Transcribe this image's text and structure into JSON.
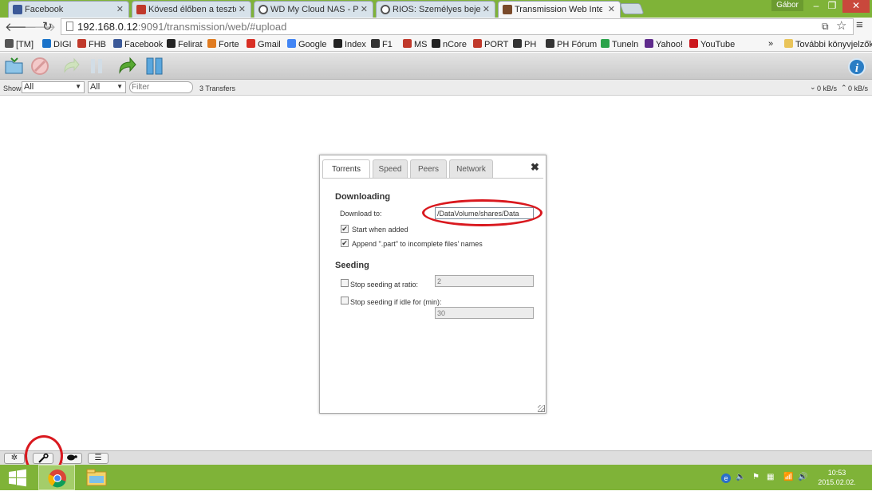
{
  "browser": {
    "tabs": [
      {
        "label": "Facebook",
        "active": false,
        "favicon_color": "#3b5998"
      },
      {
        "label": "Kövesd élőben a tesztet! -",
        "active": false,
        "favicon_color": "#c0392b"
      },
      {
        "label": "WD My Cloud NAS - PRO",
        "active": false,
        "favicon_color": "#555555"
      },
      {
        "label": "RIOS: Személyes bejegyzé",
        "active": false,
        "favicon_color": "#555555"
      },
      {
        "label": "Transmission Web Interfa",
        "active": true,
        "favicon_color": "#7a4a2a"
      }
    ],
    "user_name": "Gábor",
    "window_controls": {
      "minimize": "–",
      "maximize": "❐",
      "close": "✕"
    },
    "url_host": "192.168.0.12",
    "url_path": ":9091/transmission/web/#upload",
    "bookmarks": [
      {
        "label": "[TM]",
        "icon": "tm-icon",
        "color": "#555555"
      },
      {
        "label": "DIGI",
        "icon": "digi-icon",
        "color": "#1a73c9"
      },
      {
        "label": "FHB",
        "icon": "fhb-icon",
        "color": "#c0392b"
      },
      {
        "label": "Facebook",
        "icon": "facebook-icon",
        "color": "#3b5998"
      },
      {
        "label": "Felirat",
        "icon": "felirat-icon",
        "color": "#222222"
      },
      {
        "label": "Forte",
        "icon": "forte-icon",
        "color": "#e07b20"
      },
      {
        "label": "Gmail",
        "icon": "gmail-icon",
        "color": "#d93025"
      },
      {
        "label": "Google",
        "icon": "google-icon",
        "color": "#4285f4"
      },
      {
        "label": "Index",
        "icon": "index-icon",
        "color": "#222222"
      },
      {
        "label": "F1",
        "icon": "f1-icon",
        "color": "#333333"
      },
      {
        "label": "MS",
        "icon": "ms-icon",
        "color": "#c0392b"
      },
      {
        "label": "nCore",
        "icon": "ncore-icon",
        "color": "#222222"
      },
      {
        "label": "PORT",
        "icon": "port-icon",
        "color": "#c0392b"
      },
      {
        "label": "PH",
        "icon": "ph-icon",
        "color": "#333333"
      },
      {
        "label": "PH Fórum",
        "icon": "ph-forum-icon",
        "color": "#333333"
      },
      {
        "label": "Tuneln",
        "icon": "tunein-icon",
        "color": "#2aa34a"
      },
      {
        "label": "Yahoo!",
        "icon": "yahoo-icon",
        "color": "#5f2b8c"
      },
      {
        "label": "YouTube",
        "icon": "youtube-icon",
        "color": "#cc181e"
      }
    ],
    "bookmarks_overflow": "»",
    "other_bookmarks": "További könyvjelzők"
  },
  "transmission": {
    "filter": {
      "show_label": "Show",
      "state_value": "All",
      "tracker_value": "All",
      "filter_placeholder": "Filter",
      "transfers_count": "3 Transfers",
      "download_speed": "0 kB/s",
      "upload_speed": "0 kB/s"
    },
    "info_glyph": "i",
    "prefs": {
      "tabs": [
        "Torrents",
        "Speed",
        "Peers",
        "Network"
      ],
      "active_tab": "Torrents",
      "close_glyph": "✖",
      "downloading": {
        "heading": "Downloading",
        "download_to_label": "Download to:",
        "download_to_value": "/DataVolume/shares/Data",
        "start_when_added_label": "Start when added",
        "start_when_added_checked": true,
        "append_part_label": "Append \".part\" to incomplete files' names",
        "append_part_checked": true
      },
      "seeding": {
        "heading": "Seeding",
        "stop_ratio_label": "Stop seeding at ratio:",
        "stop_ratio_checked": false,
        "stop_ratio_value": "2",
        "stop_idle_label": "Stop seeding if idle for (min):",
        "stop_idle_checked": false,
        "stop_idle_value": "30"
      }
    },
    "bottom_buttons": [
      {
        "glyph": "✲",
        "icon": "settings-gear-icon"
      },
      {
        "glyph": "🔧",
        "icon": "wrench-icon"
      },
      {
        "glyph": "🐢",
        "icon": "turtle-icon"
      },
      {
        "glyph": "☰",
        "icon": "compact-view-icon"
      }
    ]
  },
  "annotation_color": "#d9191f",
  "taskbar": {
    "time": "10:53",
    "date": "2015.02.02."
  }
}
